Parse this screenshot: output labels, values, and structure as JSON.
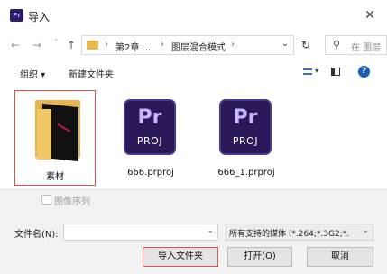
{
  "window": {
    "app_icon_text": "Pr",
    "title": "导入",
    "close_glyph": "✕"
  },
  "address": {
    "back_glyph": "←",
    "forward_glyph": "→",
    "recent_glyph": "˅",
    "up_glyph": "↑",
    "sep_glyph": "›",
    "crumbs": [
      "第2章 ...",
      "图层混合模式"
    ],
    "dropdown_glyph": "⌄",
    "refresh_glyph": "↻",
    "search_placeholder": "在 图层"
  },
  "toolbar": {
    "organize": "组织 ▾",
    "new_folder": "新建文件夹",
    "view_dd": "▾",
    "help": "?"
  },
  "files": [
    {
      "name": "素材",
      "type": "folder",
      "selected": true
    },
    {
      "name": "666.prproj",
      "type": "project",
      "icon_top": "Pr",
      "icon_bottom": "PROJ"
    },
    {
      "name": "666_1.prproj",
      "type": "project",
      "icon_top": "Pr",
      "icon_bottom": "PROJ"
    }
  ],
  "bottom": {
    "image_sequence_label": "图像序列",
    "filename_label": "文件名(N):",
    "filename_value": "",
    "dropdown_glyph": "⌄",
    "file_type": "所有支持的媒体 (*.264;*.3G2;*.",
    "buttons": {
      "import_folder": "导入文件夹",
      "open": "打开(O)",
      "cancel": "取消"
    }
  },
  "colors": {
    "accent_red": "#d9534f",
    "premiere_purple": "#2a1858",
    "folder_yellow": "#e7b54e",
    "help_blue": "#1c5fb8"
  }
}
